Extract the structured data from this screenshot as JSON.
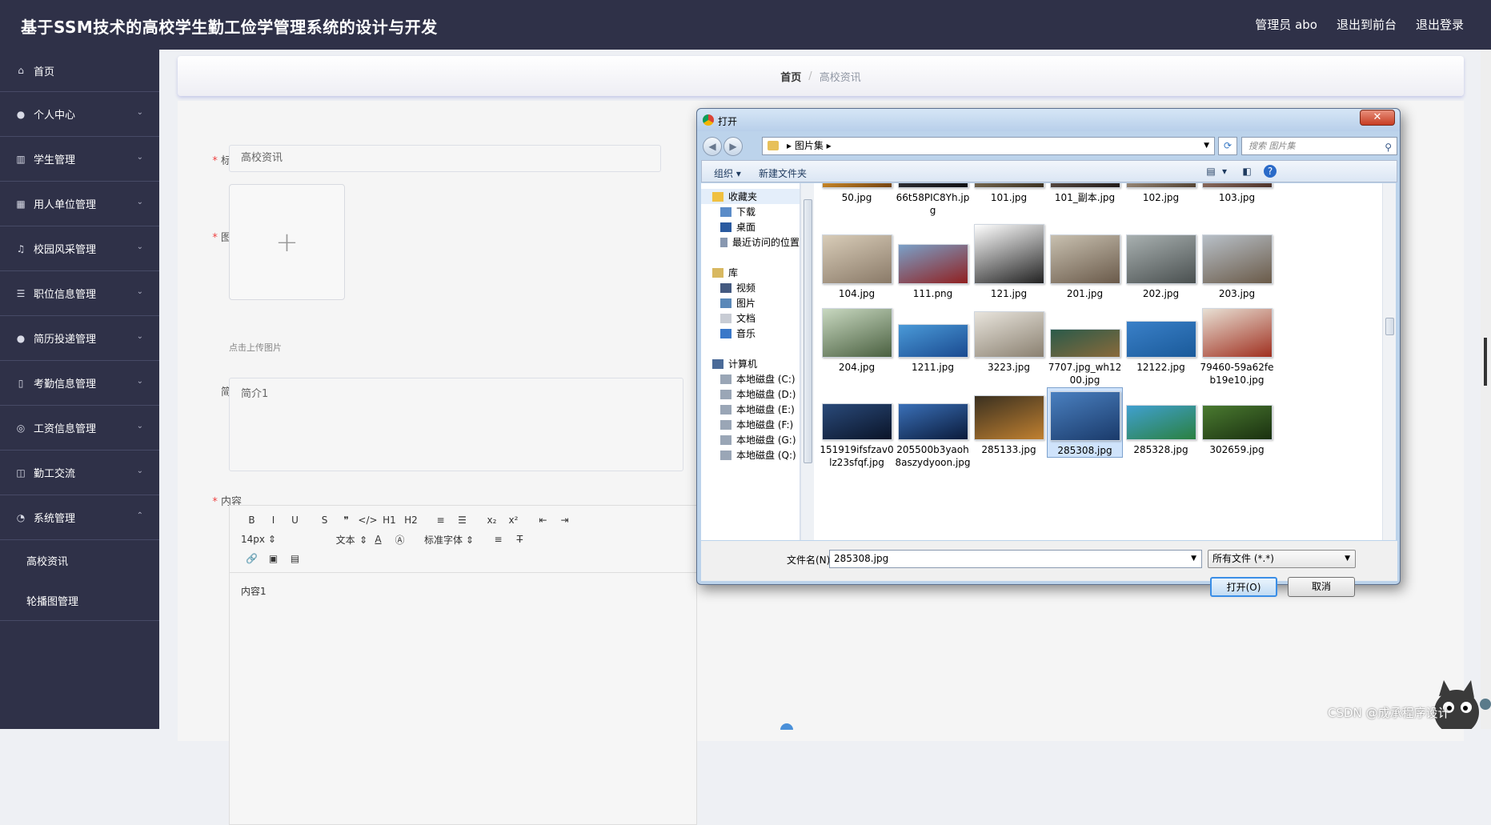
{
  "header": {
    "title": "基于SSM技术的高校学生勤工俭学管理系统的设计与开发",
    "admin": "管理员 abo",
    "to_front": "退出到前台",
    "logout": "退出登录"
  },
  "sidebar": {
    "items": [
      {
        "label": "首页",
        "icon": "home-icon"
      },
      {
        "label": "个人中心",
        "icon": "user-icon"
      },
      {
        "label": "学生管理",
        "icon": "chart-icon"
      },
      {
        "label": "用人单位管理",
        "icon": "grid-icon"
      },
      {
        "label": "校园风采管理",
        "icon": "mic-icon"
      },
      {
        "label": "职位信息管理",
        "icon": "list-icon"
      },
      {
        "label": "简历投递管理",
        "icon": "user-icon"
      },
      {
        "label": "考勤信息管理",
        "icon": "clipboard-icon"
      },
      {
        "label": "工资信息管理",
        "icon": "circle-icon"
      },
      {
        "label": "勤工交流",
        "icon": "chat-icon"
      },
      {
        "label": "系统管理",
        "icon": "gauge-icon"
      }
    ],
    "sub_items": [
      "高校资讯",
      "轮播图管理"
    ]
  },
  "breadcrumb": {
    "home": "首页",
    "separator": "/",
    "current": "高校资讯"
  },
  "form": {
    "title_label": "标题",
    "title_value": "高校资讯",
    "image_label": "图片",
    "upload_hint": "点击上传图片",
    "intro_label": "简介",
    "intro_value": "简介1",
    "content_label": "内容",
    "content_value": "内容1",
    "required_mark": "*"
  },
  "editor": {
    "font_size": "14px",
    "text_type": "文本",
    "font_family": "标准字体",
    "buttons": [
      "B",
      "I",
      "U",
      "S",
      "❞",
      "</>",
      "H1",
      "H2",
      "≡",
      "☰",
      "x₂",
      "x²",
      "⇤",
      "⇥"
    ],
    "row2_extra": [
      "A",
      "A",
      "≡",
      "T̸"
    ],
    "row3": [
      "🔗",
      "▣",
      "▤"
    ]
  },
  "dialog": {
    "title": "打开",
    "close": "✕",
    "path": "图片集",
    "search_placeholder": "搜索 图片集",
    "organize": "组织 ▾",
    "new_folder": "新建文件夹",
    "nav": [
      {
        "label": "收藏夹",
        "indent": 0,
        "icon": "star-icon",
        "color": "#f0c040"
      },
      {
        "label": "下载",
        "indent": 1,
        "icon": "download-folder-icon",
        "color": "#5b8cc8"
      },
      {
        "label": "桌面",
        "indent": 1,
        "icon": "desktop-icon",
        "color": "#2a5aa0"
      },
      {
        "label": "最近访问的位置",
        "indent": 1,
        "icon": "recent-icon",
        "color": "#8898b0"
      },
      {
        "label": "",
        "indent": 0,
        "icon": "",
        "color": ""
      },
      {
        "label": "库",
        "indent": 0,
        "icon": "library-icon",
        "color": "#d8b860"
      },
      {
        "label": "视频",
        "indent": 1,
        "icon": "video-icon",
        "color": "#445a80"
      },
      {
        "label": "图片",
        "indent": 1,
        "icon": "pictures-icon",
        "color": "#5a88b8"
      },
      {
        "label": "文档",
        "indent": 1,
        "icon": "documents-icon",
        "color": "#c8ccd4"
      },
      {
        "label": "音乐",
        "indent": 1,
        "icon": "music-icon",
        "color": "#3a78c8"
      },
      {
        "label": "",
        "indent": 0,
        "icon": "",
        "color": ""
      },
      {
        "label": "计算机",
        "indent": 0,
        "icon": "computer-icon",
        "color": "#4a6a98"
      },
      {
        "label": "本地磁盘 (C:)",
        "indent": 1,
        "icon": "drive-icon",
        "color": "#9aa6b6"
      },
      {
        "label": "本地磁盘 (D:)",
        "indent": 1,
        "icon": "drive-icon",
        "color": "#9aa6b6"
      },
      {
        "label": "本地磁盘 (E:)",
        "indent": 1,
        "icon": "drive-icon",
        "color": "#9aa6b6"
      },
      {
        "label": "本地磁盘 (F:)",
        "indent": 1,
        "icon": "drive-icon",
        "color": "#9aa6b6"
      },
      {
        "label": "本地磁盘 (G:)",
        "indent": 1,
        "icon": "drive-icon",
        "color": "#9aa6b6"
      },
      {
        "label": "本地磁盘 (Q:)",
        "indent": 1,
        "icon": "drive-icon",
        "color": "#9aa6b6"
      }
    ],
    "files": [
      {
        "name": "50.jpg",
        "c1": "#e8a030",
        "c2": "#704010"
      },
      {
        "name": "66t58PIC8Yh.jpg",
        "c1": "#3a3a40",
        "c2": "#101012"
      },
      {
        "name": "101.jpg",
        "c1": "#8a7a60",
        "c2": "#3a3020"
      },
      {
        "name": "101_副本.jpg",
        "c1": "#6a5a50",
        "c2": "#201a18"
      },
      {
        "name": "102.jpg",
        "c1": "#b0a090",
        "c2": "#504030"
      },
      {
        "name": "103.jpg",
        "c1": "#a08070",
        "c2": "#4a3028"
      },
      {
        "name": "104.jpg",
        "c1": "#d8ccb8",
        "c2": "#8a7a68"
      },
      {
        "name": "111.png",
        "c1": "#7aa0c8",
        "c2": "#902020"
      },
      {
        "name": "121.jpg",
        "c1": "#ffffff",
        "c2": "#222222"
      },
      {
        "name": "201.jpg",
        "c1": "#c8c0b0",
        "c2": "#6a5a4a"
      },
      {
        "name": "202.jpg",
        "c1": "#a8b0b0",
        "c2": "#4a5050"
      },
      {
        "name": "203.jpg",
        "c1": "#b8c0c8",
        "c2": "#6a5a48"
      },
      {
        "name": "204.jpg",
        "c1": "#c8d8c0",
        "c2": "#4a6040"
      },
      {
        "name": "1211.jpg",
        "c1": "#4a9ad8",
        "c2": "#1a4a90"
      },
      {
        "name": "3223.jpg",
        "c1": "#e8e4dc",
        "c2": "#8a8070"
      },
      {
        "name": "7707.jpg_wh1200.jpg",
        "c1": "#2a5a4a",
        "c2": "#8a6a3a"
      },
      {
        "name": "12122.jpg",
        "c1": "#3a80c8",
        "c2": "#1a5a9a"
      },
      {
        "name": "79460-59a62feb19e10.jpg",
        "c1": "#e8e0d4",
        "c2": "#a03020"
      },
      {
        "name": "151919ifsfzav0lz23sfqf.jpg",
        "c1": "#2a4a7a",
        "c2": "#0a1428"
      },
      {
        "name": "205500b3yaoh8aszydyoon.jpg",
        "c1": "#3a70b8",
        "c2": "#0a1a3a"
      },
      {
        "name": "285133.jpg",
        "c1": "#3a3020",
        "c2": "#c08030"
      },
      {
        "name": "285308.jpg",
        "c1": "#4a80c0",
        "c2": "#1a3a6a"
      },
      {
        "name": "285328.jpg",
        "c1": "#40a0d0",
        "c2": "#2a8040"
      },
      {
        "name": "302659.jpg",
        "c1": "#4a7a30",
        "c2": "#1a3010"
      }
    ],
    "selected_file": "285308.jpg",
    "filename_label": "文件名(N):",
    "filename_value": "285308.jpg",
    "filetype": "所有文件 (*.*)",
    "open_button": "打开(O)",
    "cancel_button": "取消"
  },
  "watermark": "CSDN @成承程序设计"
}
